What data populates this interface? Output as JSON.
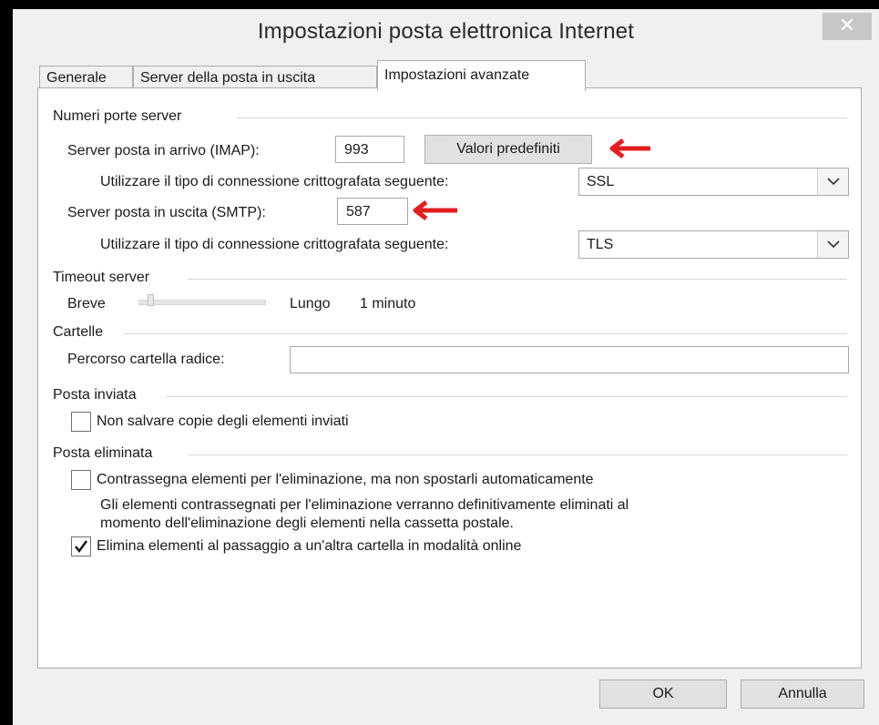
{
  "window": {
    "title": "Impostazioni posta elettronica Internet",
    "close_glyph": "✕"
  },
  "tabs": [
    {
      "label": "Generale",
      "active": false
    },
    {
      "label": "Server della posta in uscita",
      "active": false
    },
    {
      "label": "Impostazioni avanzate",
      "active": true
    }
  ],
  "ports": {
    "section_title": "Numeri porte server",
    "incoming_label": "Server posta in arrivo (IMAP):",
    "incoming_value": "993",
    "defaults_button": "Valori predefiniti",
    "incoming_enc_label": "Utilizzare il tipo di connessione crittografata seguente:",
    "incoming_enc_value": "SSL",
    "outgoing_label": "Server posta in uscita (SMTP):",
    "outgoing_value": "587",
    "outgoing_enc_label": "Utilizzare il tipo di connessione crittografata seguente:",
    "outgoing_enc_value": "TLS"
  },
  "timeout": {
    "section_title": "Timeout server",
    "short_label": "Breve",
    "long_label": "Lungo",
    "value_text": "1 minuto"
  },
  "folders": {
    "section_title": "Cartelle",
    "root_label": "Percorso cartella radice:",
    "root_value": ""
  },
  "sent": {
    "section_title": "Posta inviata",
    "no_copies_label": "Non salvare copie degli elementi inviati",
    "no_copies_checked": false
  },
  "deleted": {
    "section_title": "Posta eliminata",
    "mark_label": "Contrassegna elementi per l'eliminazione, ma non spostarli automaticamente",
    "mark_checked": false,
    "note_line1": "Gli elementi contrassegnati per l'eliminazione verranno definitivamente eliminati al",
    "note_line2": "momento dell'eliminazione degli elementi nella cassetta postale.",
    "purge_label": "Elimina elementi al passaggio a un'altra cartella in modalità online",
    "purge_checked": true
  },
  "footer": {
    "ok_label": "OK",
    "cancel_label": "Annulla"
  },
  "colors": {
    "arrow": "#e21f1f",
    "panel": "#ffffff",
    "chrome": "#f0f0f0"
  }
}
